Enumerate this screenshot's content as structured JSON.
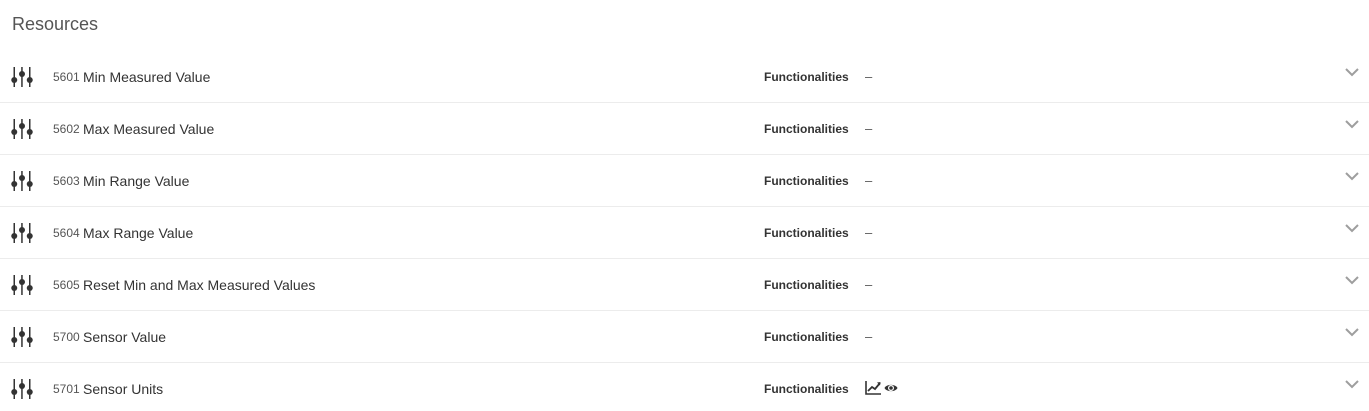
{
  "section": {
    "title": "Resources"
  },
  "functionalities_label": "Functionalities",
  "resources": [
    {
      "id": "5601",
      "name": "Min Measured Value",
      "functionalities": "–"
    },
    {
      "id": "5602",
      "name": "Max Measured Value",
      "functionalities": "–"
    },
    {
      "id": "5603",
      "name": "Min Range Value",
      "functionalities": "–"
    },
    {
      "id": "5604",
      "name": "Max Range Value",
      "functionalities": "–"
    },
    {
      "id": "5605",
      "name": "Reset Min and Max Measured Values",
      "functionalities": "–"
    },
    {
      "id": "5700",
      "name": "Sensor Value",
      "functionalities": "–"
    },
    {
      "id": "5701",
      "name": "Sensor Units",
      "functionalities": "",
      "functionality_icons": [
        "line-chart-icon",
        "eye-icon"
      ]
    }
  ],
  "icons": {
    "row_icon": "sliders-icon",
    "expand_icon": "chevron-down-icon"
  },
  "colors": {
    "text": "#333333",
    "muted": "#555555",
    "divider": "#ececec",
    "chevron": "#9e9e9e"
  }
}
